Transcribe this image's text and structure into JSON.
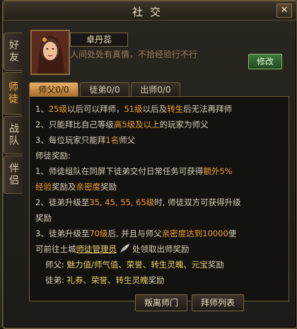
{
  "window": {
    "title": "社交",
    "close_label": "✕"
  },
  "side_tabs": [
    {
      "label": "好友",
      "active": false
    },
    {
      "label": "师徒",
      "active": true
    },
    {
      "label": "战队",
      "active": false
    },
    {
      "label": "伴侣",
      "active": false
    }
  ],
  "profile": {
    "name": "卓丹蕊",
    "motto": "人间处处有真情，不拾经验行不行",
    "edit_label": "修改"
  },
  "tabs": [
    {
      "label": "师父0/0",
      "active": true
    },
    {
      "label": "徒弟0/0",
      "active": false
    },
    {
      "label": "出师0/0",
      "active": false
    }
  ],
  "rules": {
    "r1_a": "1、",
    "r1_b": "25级",
    "r1_c": "以后可以拜师，",
    "r1_d": "51级",
    "r1_e": "以后及",
    "r1_f": "转生",
    "r1_g": "后无法再拜师",
    "r2_a": "2、只能拜比自己等级",
    "r2_b": "高5级及以上",
    "r2_c": "的玩家为师父",
    "r3_a": "3、每位玩家只能拜",
    "r3_b": "1名",
    "r3_c": "师父",
    "reward_title": "师徒奖励:",
    "w1_a": "1、师徒组队在同屏下徒弟交付日常任务可获得",
    "w1_b": "额外5%",
    "w1_c": "经验",
    "w1_d": "奖励及",
    "w1_e": "亲密度",
    "w1_f": "奖励",
    "w2_a": "2、徒弟升级至",
    "w2_b": "35, 45, 55, 65级",
    "w2_c": "时, 师徒双方可获得升级",
    "w2_d": "奖励",
    "w3_a": "3、徒弟升级至",
    "w3_b": "70级",
    "w3_c": "后, 并且与师父",
    "w3_d": "亲密度达到10000",
    "w3_e": "便",
    "w3_f": "可前往土城",
    "w3_g": "师徒管理员",
    "w3_h": "处领取出师奖励",
    "m_label": "师父: ",
    "m_items": "魅力值/师气值、荣誉、转生灵魄、元宝",
    "m_suffix": "奖励",
    "s_label": "徒弟: ",
    "s_items": "礼券、荣誉、转生灵魄",
    "s_suffix": "奖励"
  },
  "buttons": {
    "leave": "叛离师门",
    "list": "拜师列表"
  },
  "colors": {
    "accent_orange": "#f0a030",
    "accent_green": "#8cd46a",
    "frame": "#6b5a3c"
  }
}
